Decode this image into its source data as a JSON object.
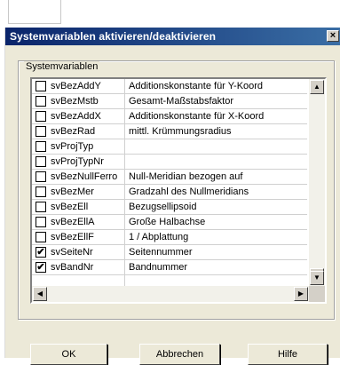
{
  "dialog": {
    "title": "Systemvariablen aktivieren/deaktivieren",
    "close_glyph": "×"
  },
  "group": {
    "label": "Systemvariablen"
  },
  "rows": [
    {
      "name": "svBezAddY",
      "desc": "Additionskonstante für Y-Koord",
      "checked": false
    },
    {
      "name": "svBezMstb",
      "desc": "Gesamt-Maßstabsfaktor",
      "checked": false
    },
    {
      "name": "svBezAddX",
      "desc": "Additionskonstante für X-Koord",
      "checked": false
    },
    {
      "name": "svBezRad",
      "desc": "mittl. Krümmungsradius",
      "checked": false
    },
    {
      "name": "svProjTyp",
      "desc": "",
      "checked": false
    },
    {
      "name": "svProjTypNr",
      "desc": "",
      "checked": false
    },
    {
      "name": "svBezNullFerro",
      "desc": "Null-Meridian bezogen auf",
      "checked": false
    },
    {
      "name": "svBezMer",
      "desc": "Gradzahl des Nullmeridians",
      "checked": false
    },
    {
      "name": "svBezEll",
      "desc": "Bezugsellipsoid",
      "checked": false
    },
    {
      "name": "svBezEllA",
      "desc": "Große Halbachse",
      "checked": false
    },
    {
      "name": "svBezEllF",
      "desc": "1 / Abplattung",
      "checked": false
    },
    {
      "name": "svSeiteNr",
      "desc": "Seitennummer",
      "checked": true
    },
    {
      "name": "svBandNr",
      "desc": "Bandnummer",
      "checked": true
    }
  ],
  "buttons": {
    "ok": "OK",
    "cancel": "Abbrechen",
    "help": "Hilfe"
  },
  "icons": {
    "up": "▲",
    "down": "▼",
    "left": "◀",
    "right": "▶",
    "check": "✔"
  }
}
